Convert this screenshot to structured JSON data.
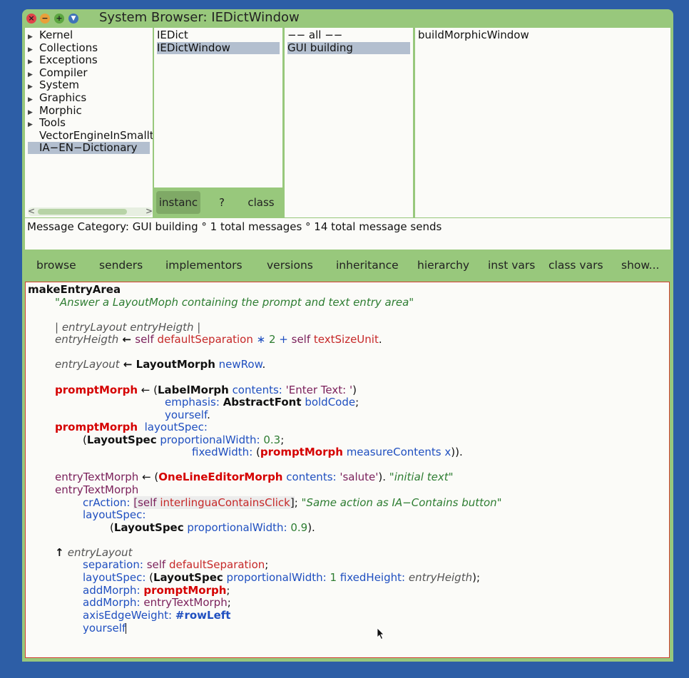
{
  "window": {
    "title": "System Browser: IEDictWindow"
  },
  "categories": [
    {
      "label": "Kernel",
      "expandable": true
    },
    {
      "label": "Collections",
      "expandable": true
    },
    {
      "label": "Exceptions",
      "expandable": true
    },
    {
      "label": "Compiler",
      "expandable": true
    },
    {
      "label": "System",
      "expandable": true
    },
    {
      "label": "Graphics",
      "expandable": true
    },
    {
      "label": "Morphic",
      "expandable": true
    },
    {
      "label": "Tools",
      "expandable": true
    },
    {
      "label": "VectorEngineInSmallt",
      "expandable": false
    },
    {
      "label": "IA−EN−Dictionary",
      "expandable": false,
      "selected": true
    }
  ],
  "classes": [
    {
      "label": "IEDict"
    },
    {
      "label": "IEDictWindow",
      "selected": true
    }
  ],
  "class_switch": {
    "instance": "instanc",
    "help": "?",
    "class": "class"
  },
  "message_categories": [
    {
      "label": "−− all −−"
    },
    {
      "label": "GUI building",
      "selected": true
    }
  ],
  "messages": [
    {
      "label": "buildMorphicWindow"
    }
  ],
  "info_line": "Message Category: GUI building ° 1 total messages ° 14 total message sends",
  "toolbar": {
    "browse": "browse",
    "senders": "senders",
    "implementors": "implementors",
    "versions": "versions",
    "inheritance": "inheritance",
    "hierarchy": "hierarchy",
    "inst_vars": "inst vars",
    "class_vars": "class vars",
    "show": "show..."
  },
  "code": {
    "l01": [
      "makeEntryArea"
    ],
    "l02": [
      "\"Answer a LayoutMoph containing the prompt and text entry area\""
    ],
    "l03": [
      "| entryLayout entryHeigth |"
    ],
    "l04": [
      "entryHeigth",
      " ← ",
      "self ",
      "defaultSeparation",
      " ∗ ",
      "2",
      " + ",
      "self ",
      "textSizeUnit",
      "."
    ],
    "l05": [
      "entryLayout",
      " ← ",
      "LayoutMorph",
      " ",
      "newRow",
      "."
    ],
    "l06": [
      "promptMorph",
      " ← (",
      "LabelMorph",
      " ",
      "contents:",
      " ",
      "'Enter Text: '",
      ")"
    ],
    "l07": [
      "emphasis:",
      " ",
      "AbstractFont",
      " ",
      "boldCode",
      ";"
    ],
    "l08": [
      "yourself",
      "."
    ],
    "l09": [
      "promptMorph",
      "  ",
      "layoutSpec:"
    ],
    "l10": [
      "(",
      "LayoutSpec",
      " ",
      "proportionalWidth:",
      " ",
      "0.3",
      ";"
    ],
    "l11": [
      "fixedWidth:",
      " (",
      "promptMorph",
      " ",
      "measureContents x",
      "))."
    ],
    "l12": [
      "entryTextMorph",
      " ← (",
      "OneLineEditorMorph",
      " ",
      "contents:",
      " ",
      "'salute'",
      "). ",
      "\"initial text\""
    ],
    "l13": [
      "entryTextMorph"
    ],
    "l14": [
      "crAction:",
      " ",
      "[self ",
      "interlinguaContainsClick",
      "]",
      "; ",
      "\"Same action as IA−Contains button\""
    ],
    "l15": [
      "layoutSpec:"
    ],
    "l16": [
      "(",
      "LayoutSpec",
      " ",
      "proportionalWidth:",
      " ",
      "0.9",
      ")."
    ],
    "l17": [
      "↑ ",
      "entryLayout"
    ],
    "l18": [
      "separation:",
      " ",
      "self ",
      "defaultSeparation",
      ";"
    ],
    "l19": [
      "layoutSpec:",
      " (",
      "LayoutSpec",
      " ",
      "proportionalWidth:",
      " ",
      "1",
      " ",
      "fixedHeight:",
      " ",
      "entryHeigth",
      ");"
    ],
    "l20": [
      "addMorph:",
      " ",
      "promptMorph",
      ";"
    ],
    "l21": [
      "addMorph:",
      " ",
      "entryTextMorph",
      ";"
    ],
    "l22": [
      "axisEdgeWeight:",
      " ",
      "#rowLeft"
    ],
    "l23": [
      "yourself"
    ]
  },
  "colors": {
    "desktop": "#2d5ea6",
    "window_frame": "#98c87c",
    "pane_bg": "#fbfbf8",
    "selection": "#b3bfcf",
    "close": "#e0424a",
    "minimize": "#e9a03a",
    "maximize": "#5ca640",
    "menu": "#3f73b8"
  },
  "icons": [
    "close-icon",
    "minimize-icon",
    "maximize-icon",
    "window-menu-icon",
    "expand-triangle-icon",
    "scroll-left-icon",
    "scroll-right-icon",
    "mouse-pointer-icon"
  ]
}
